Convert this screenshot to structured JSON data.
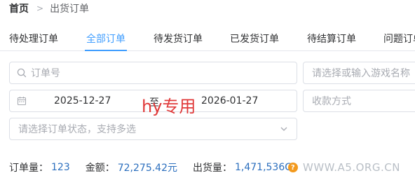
{
  "breadcrumb": {
    "home": "首页",
    "separator": ">",
    "current": "出货订单"
  },
  "tabs": [
    {
      "label": "待处理订单",
      "active": false
    },
    {
      "label": "全部订单",
      "active": true
    },
    {
      "label": "待发货订单",
      "active": false
    },
    {
      "label": "已发货订单",
      "active": false
    },
    {
      "label": "待结算订单",
      "active": false
    },
    {
      "label": "问题订单",
      "active": false
    }
  ],
  "filters": {
    "order_no_placeholder": "订单号",
    "game_placeholder": "请选择或输入游戏名称",
    "date_start": "2025-12-27",
    "date_separator": "至",
    "date_end": "2026-01-27",
    "payment_placeholder": "收款方式",
    "status_placeholder": "请选择订单状态，支持多选"
  },
  "overlay_text": "hy专用",
  "stats": {
    "order_count_label": "订单量：",
    "order_count": "123",
    "amount_label": "金额：",
    "amount": "72,275.42元",
    "shipped_label": "出货量：",
    "shipped": "1,471,536G"
  },
  "watermark": "WWW.A5.ORG.CN",
  "colors": {
    "accent": "#409eff",
    "value": "#2c6fbe",
    "overlay": "#e03a3a",
    "watermark_dot": "#f39a1e"
  },
  "icons": {
    "search": "search-icon",
    "calendar": "calendar-icon",
    "dropdown": "chevron-down-icon"
  }
}
